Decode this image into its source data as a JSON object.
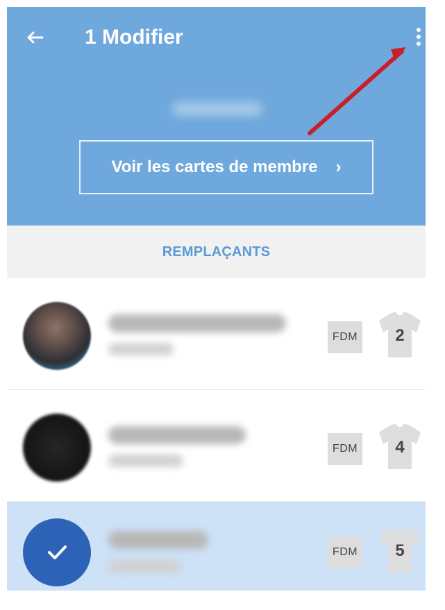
{
  "header": {
    "title": "1 Modifier",
    "member_cards_button": "Voir les cartes de membre",
    "member_cards_chevron": "›"
  },
  "section": {
    "title": "REMPLAÇANTS"
  },
  "players": [
    {
      "badge": "FDM",
      "number": "2",
      "selected": false
    },
    {
      "badge": "FDM",
      "number": "4",
      "selected": false
    },
    {
      "badge": "FDM",
      "number": "5",
      "selected": true
    }
  ],
  "icons": {
    "back": "arrow-left-icon",
    "menu": "more-vertical-icon",
    "check": "checkmark-icon",
    "shirt": "jersey-icon"
  },
  "colors": {
    "header": "#6fa8dc",
    "section_background": "#f1f1f1",
    "selected_row": "#cde1f7",
    "selected_avatar": "#2d63b7",
    "annotation_arrow": "#c81f2a"
  }
}
